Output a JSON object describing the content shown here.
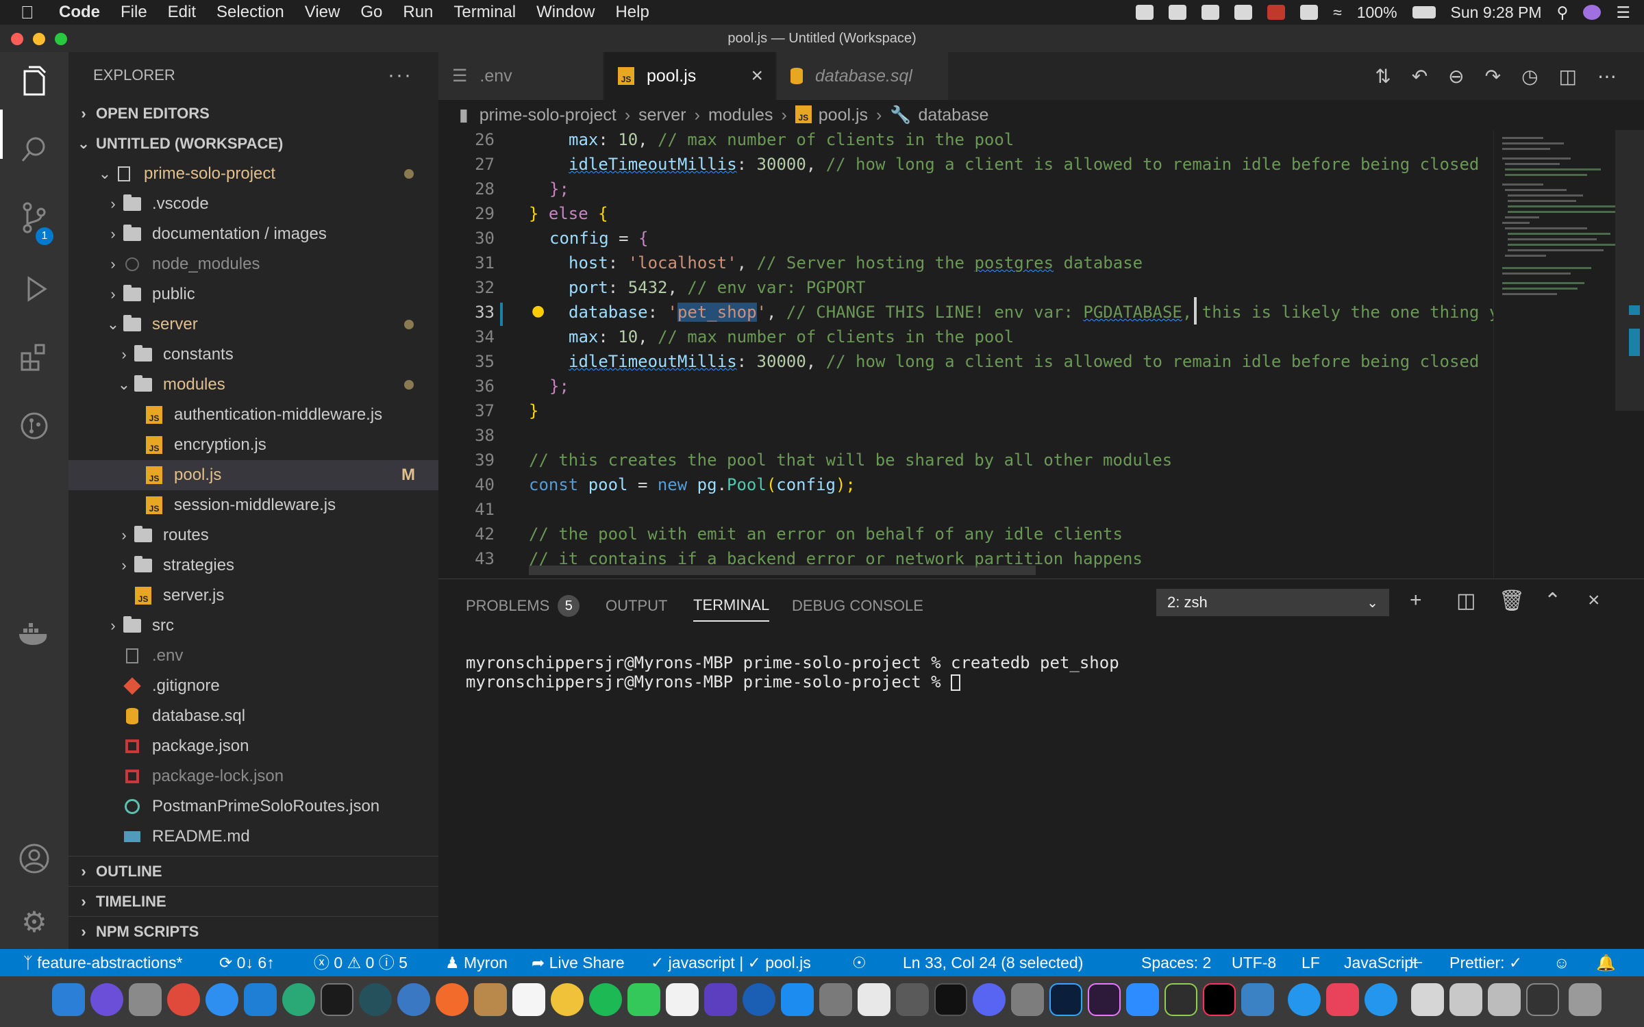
{
  "menubar": {
    "app": "Code",
    "items": [
      "File",
      "Edit",
      "Selection",
      "View",
      "Go",
      "Run",
      "Terminal",
      "Window",
      "Help"
    ],
    "battery": "100%",
    "clock": "Sun 9:28 PM"
  },
  "window": {
    "title": "pool.js — Untitled (Workspace)"
  },
  "activity": {
    "scm_badge": "1"
  },
  "explorer": {
    "title": "EXPLORER",
    "more": "···",
    "sections": {
      "open_editors": "OPEN EDITORS",
      "workspace": "UNTITLED (WORKSPACE)",
      "outline": "OUTLINE",
      "timeline": "TIMELINE",
      "npm": "NPM SCRIPTS"
    },
    "tree": [
      {
        "label": "prime-solo-project"
      },
      {
        "label": ".vscode"
      },
      {
        "label": "documentation / images"
      },
      {
        "label": "node_modules"
      },
      {
        "label": "public"
      },
      {
        "label": "server"
      },
      {
        "label": "constants"
      },
      {
        "label": "modules"
      },
      {
        "label": "authentication-middleware.js"
      },
      {
        "label": "encryption.js"
      },
      {
        "label": "pool.js",
        "badge": "M"
      },
      {
        "label": "session-middleware.js"
      },
      {
        "label": "routes"
      },
      {
        "label": "strategies"
      },
      {
        "label": "server.js"
      },
      {
        "label": "src"
      },
      {
        "label": ".env"
      },
      {
        "label": ".gitignore"
      },
      {
        "label": "database.sql"
      },
      {
        "label": "package.json"
      },
      {
        "label": "package-lock.json"
      },
      {
        "label": "PostmanPrimeSoloRoutes.json"
      },
      {
        "label": "README.md"
      }
    ]
  },
  "tabs": [
    {
      "label": ".env"
    },
    {
      "label": "pool.js"
    },
    {
      "label": "database.sql"
    }
  ],
  "breadcrumb": [
    "prime-solo-project",
    "server",
    "modules",
    "pool.js",
    "database"
  ],
  "editor": {
    "line_numbers": [
      "26",
      "27",
      "28",
      "29",
      "30",
      "31",
      "32",
      "33",
      "34",
      "35",
      "36",
      "37",
      "38",
      "39",
      "40",
      "41",
      "42",
      "43"
    ],
    "lines": {
      "l26": [
        "max",
        ": ",
        "10",
        ", ",
        "// max number of clients in the pool"
      ],
      "l27": [
        "idleTimeoutMillis",
        ": ",
        "30000",
        ", ",
        "// how long a client is allowed to remain idle before being closed"
      ],
      "l28": [
        "};"
      ],
      "l29": [
        "}",
        " else ",
        "{"
      ],
      "l30": [
        "config",
        " = ",
        "{"
      ],
      "l31": [
        "host",
        ": ",
        "'localhost'",
        ", ",
        "// Server hosting the ",
        "postgres",
        " database"
      ],
      "l32": [
        "port",
        ": ",
        "5432",
        ", ",
        "// env var: PGPORT"
      ],
      "l33": [
        "database",
        ": ",
        "'",
        "pet_shop",
        "'",
        ", ",
        "// CHANGE THIS LINE! env var: ",
        "PGDATABASE",
        ", this is likely the one thing y"
      ],
      "l34": [
        "max",
        ": ",
        "10",
        ", ",
        "// max number of clients in the pool"
      ],
      "l35": [
        "idleTimeoutMillis",
        ": ",
        "30000",
        ", ",
        "// how long a client is allowed to remain idle before being closed"
      ],
      "l36": [
        "};"
      ],
      "l37": [
        "}"
      ],
      "l39": [
        "// this creates the pool that will be shared by all other modules"
      ],
      "l40": [
        "const",
        " ",
        "pool",
        " = ",
        "new",
        " ",
        "pg",
        ".",
        "Pool",
        "(",
        "config",
        ");"
      ],
      "l42": [
        "// the pool with emit an error on behalf of any idle clients"
      ],
      "l43": [
        "// it contains if a backend error or network partition happens"
      ]
    }
  },
  "panel": {
    "tabs": {
      "problems": "PROBLEMS",
      "problems_count": "5",
      "output": "OUTPUT",
      "terminal": "TERMINAL",
      "debug": "DEBUG CONSOLE"
    },
    "terminal_select": "2: zsh",
    "terminal_lines": [
      "myronschippersjr@Myrons-MBP prime-solo-project % createdb pet_shop",
      "myronschippersjr@Myrons-MBP prime-solo-project % "
    ]
  },
  "statusbar": {
    "branch": "feature-abstractions*",
    "sync": "0↓ 6↑",
    "problems": "ⓧ 0 ⚠ 0 ⓘ 5",
    "user": "Myron",
    "live_share": "Live Share",
    "lang_check": "✓ javascript | ✓ pool.js",
    "position": "Ln 33, Col 24 (8 selected)",
    "spaces": "Spaces: 2",
    "encoding": "UTF-8",
    "eol": "LF",
    "language": "JavaScript",
    "prettier": "Prettier: ✓"
  },
  "colors": {
    "accent": "#007acc",
    "editor_bg": "#1e1e1e",
    "sidebar_bg": "#252526"
  }
}
